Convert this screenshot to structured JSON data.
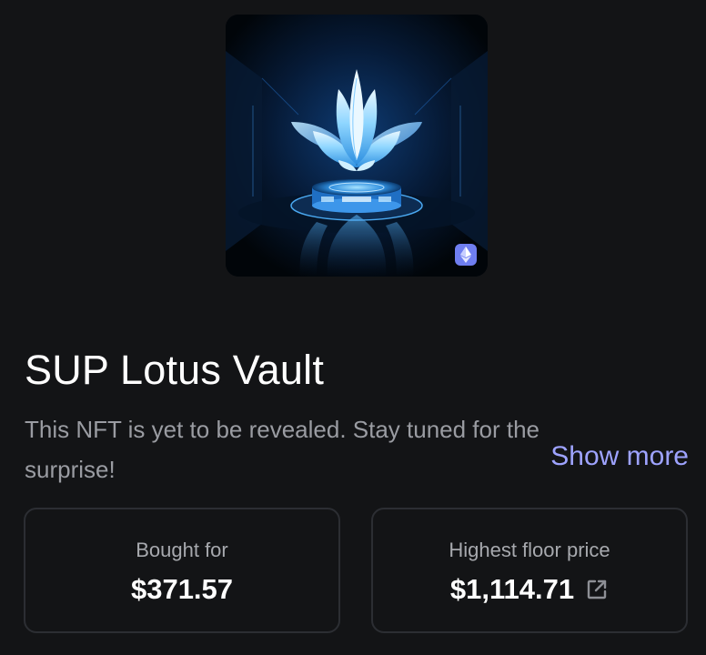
{
  "nft": {
    "image_icon": "lotus-crystal-artwork",
    "chain_icon": "ethereum-icon",
    "chain_color": "#6f7ef0",
    "title": "SUP Lotus Vault",
    "description": "This NFT is yet to be revealed. Stay tuned for the surprise!",
    "show_more_label": "Show more"
  },
  "stats": {
    "bought_for_label": "Bought for",
    "bought_for_value": "$371.57",
    "floor_label": "Highest floor price",
    "floor_value": "$1,114.71",
    "floor_link_icon": "external-link-icon"
  },
  "colors": {
    "background": "#131416",
    "accent": "#9ea3ff",
    "card_border": "#2c2e33",
    "muted_text": "#9a9ca2"
  }
}
